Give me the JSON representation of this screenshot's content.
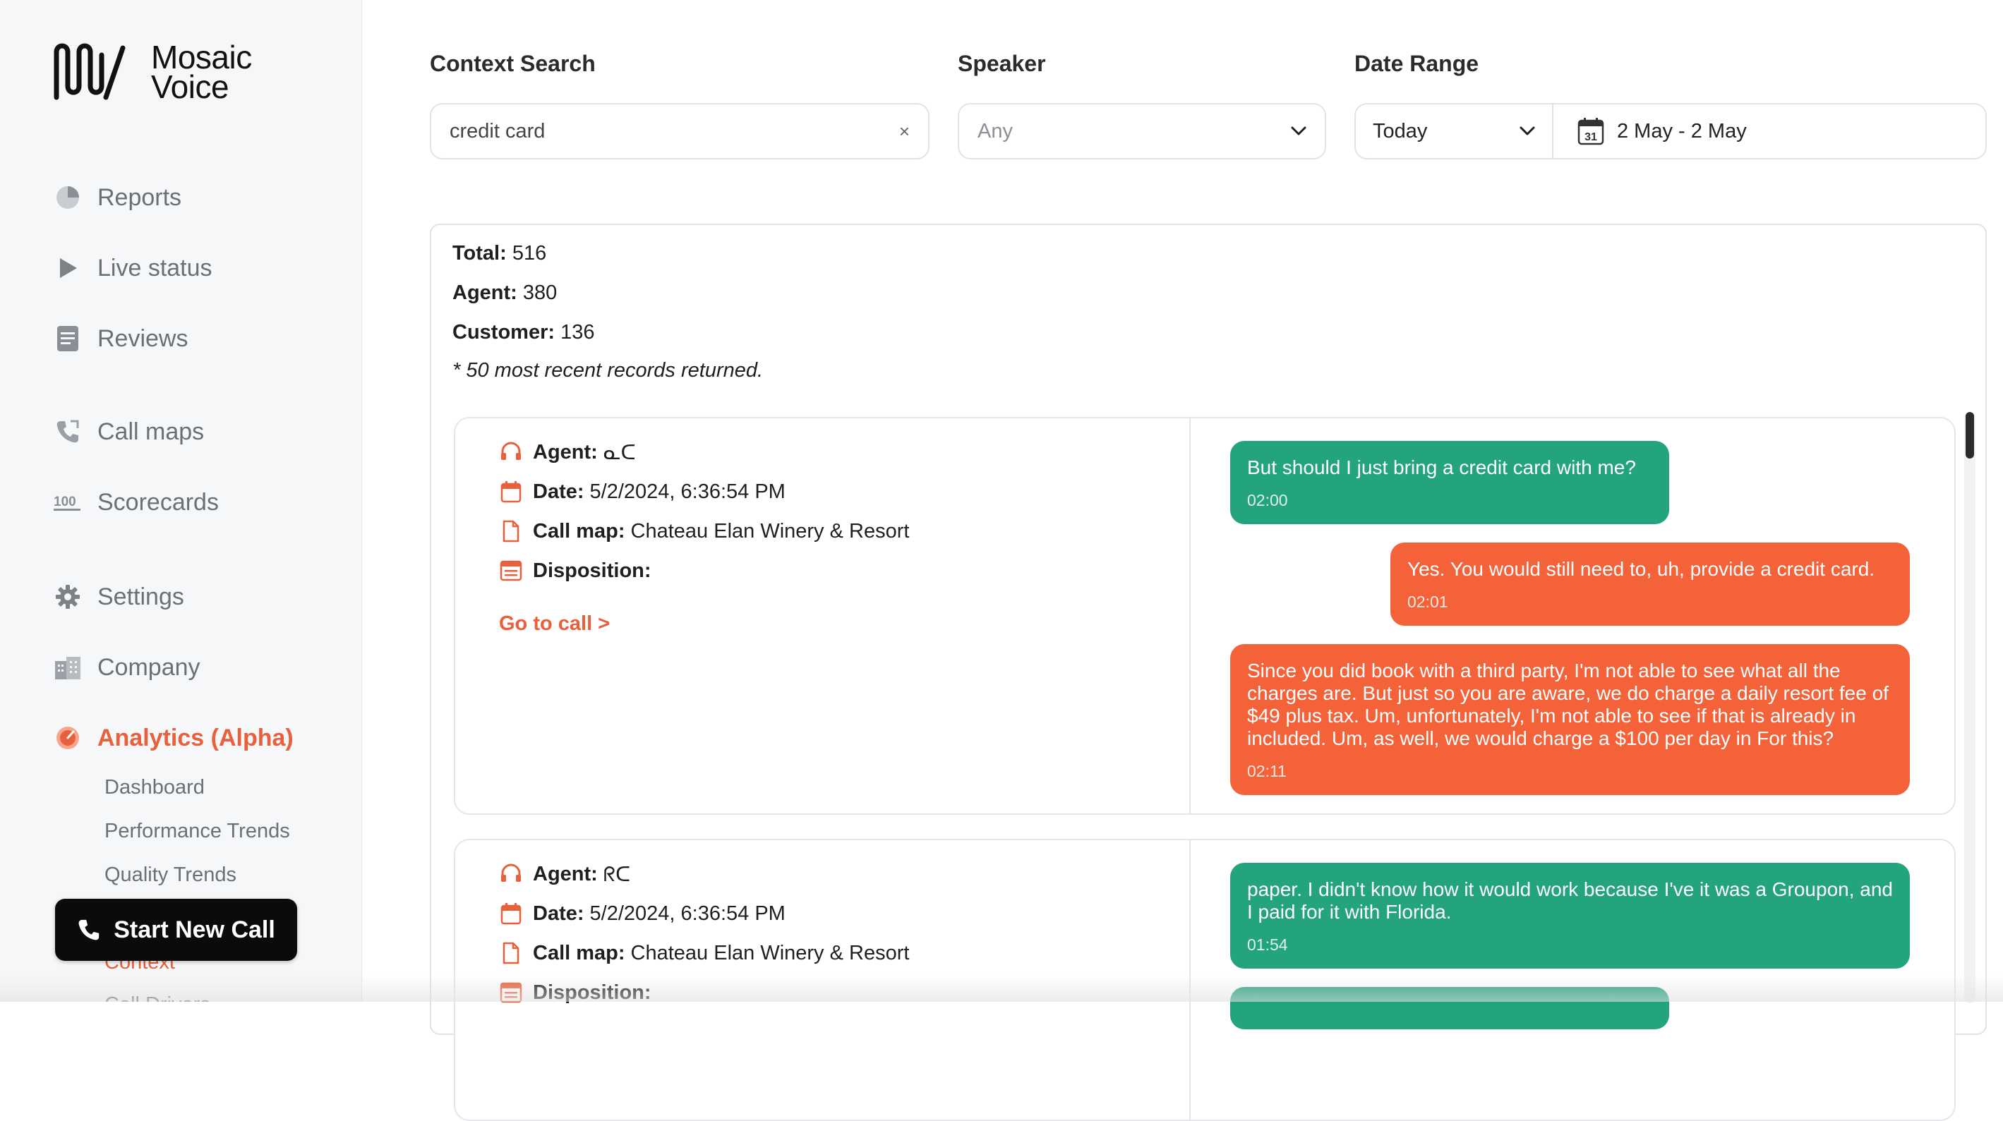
{
  "brand": {
    "logo_line1": "Mosaic",
    "logo_line2": "Voice",
    "accent": "#e8603c"
  },
  "sidebar": {
    "items": [
      {
        "label": "Reports",
        "icon": "pie-chart-icon"
      },
      {
        "label": "Live status",
        "icon": "play-icon"
      },
      {
        "label": "Reviews",
        "icon": "document-icon"
      },
      {
        "label": "Call maps",
        "icon": "phone-call-icon"
      },
      {
        "label": "Scorecards",
        "icon": "hundred-icon"
      },
      {
        "label": "Settings",
        "icon": "gear-icon"
      },
      {
        "label": "Company",
        "icon": "building-icon"
      },
      {
        "label": "Analytics (Alpha)",
        "icon": "gauge-icon",
        "active": true
      }
    ],
    "sub_items": [
      "Dashboard",
      "Performance Trends",
      "Quality Trends",
      "Context",
      "Call Drivers"
    ],
    "start_call_label": "Start New Call"
  },
  "filters": {
    "context_label": "Context Search",
    "context_value": "credit card",
    "clear_glyph": "×",
    "speaker_label": "Speaker",
    "speaker_placeholder": "Any",
    "date_label": "Date Range",
    "date_preset": "Today",
    "date_range": "2 May - 2 May",
    "calendar_day": "31"
  },
  "summary": {
    "total_label": "Total:",
    "total": "516",
    "agent_label": "Agent:",
    "agent": "380",
    "customer_label": "Customer:",
    "customer": "136",
    "note": "* 50 most recent records returned."
  },
  "labels": {
    "agent": "Agent:",
    "date": "Date:",
    "call_map": "Call map:",
    "disposition": "Disposition:",
    "goto": "Go to call >"
  },
  "results": [
    {
      "agent": "ᓇᑕ",
      "date": "5/2/2024, 6:36:54 PM",
      "call_map": "Chateau Elan Winery & Resort",
      "disposition": "",
      "messages": [
        {
          "speaker": "customer",
          "text": "But should I just bring a credit card with me?",
          "time": "02:00"
        },
        {
          "speaker": "agent",
          "text": "Yes. You would still need to, uh, provide a credit card.",
          "time": "02:01"
        },
        {
          "speaker": "agent",
          "text": "Since you did book with a third party, I'm not able to see what all the charges are. But just so you are aware, we do charge a daily resort fee of $49 plus tax. Um, unfortunately, I'm not able to see if that is already in included. Um, as well, we would charge a $100 per day in For this?",
          "time": "02:11"
        }
      ]
    },
    {
      "agent": "ᖇᑕ",
      "date": "5/2/2024, 6:36:54 PM",
      "call_map": "Chateau Elan Winery & Resort",
      "disposition": "",
      "messages": [
        {
          "speaker": "customer",
          "text": "paper. I didn't know how it would work because I've it was a Groupon, and I paid for it with Florida.",
          "time": "01:54"
        }
      ]
    }
  ]
}
